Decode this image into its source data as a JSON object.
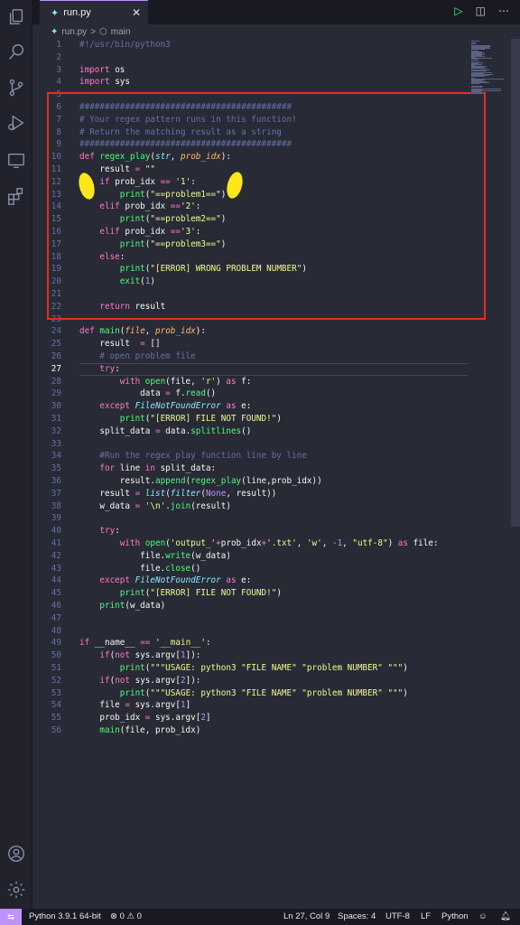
{
  "tab": {
    "icon": "python-file-icon",
    "name": "run.py",
    "close": "✕"
  },
  "breadcrumb": {
    "file": "run.py",
    "separator": ">",
    "symbol": "main"
  },
  "code_lines": [
    {
      "n": "1",
      "html": "<span class=\"cm\">#!/usr/bin/python3</span>"
    },
    {
      "n": "2",
      "html": ""
    },
    {
      "n": "3",
      "html": "<span class=\"kw\">import</span> os"
    },
    {
      "n": "4",
      "html": "<span class=\"kw\">import</span> sys"
    },
    {
      "n": "5",
      "html": ""
    },
    {
      "n": "6",
      "html": "<span class=\"cm\">##########################################</span>"
    },
    {
      "n": "7",
      "html": "<span class=\"cm\"># Your regex pattern runs in this function!</span>"
    },
    {
      "n": "8",
      "html": "<span class=\"cm\"># Return the matching result as a string</span>"
    },
    {
      "n": "9",
      "html": "<span class=\"cm\">##########################################</span>"
    },
    {
      "n": "10",
      "html": "<span class=\"kw\">def</span> <span class=\"fn\">regex_play</span>(<span class=\"bi\">str</span>, <span class=\"pa\">prob_idx</span>):"
    },
    {
      "n": "11",
      "html": "    result <span class=\"kw\">=</span> <span class=\"st\">\"\"</span>"
    },
    {
      "n": "12",
      "html": "    <span class=\"kw\">if</span> prob_idx <span class=\"kw\">==</span> <span class=\"st\">'1'</span>:"
    },
    {
      "n": "13",
      "html": "        <span class=\"fn\">print</span>(<span class=\"st\">\"==problem1==\"</span>)"
    },
    {
      "n": "14",
      "html": "    <span class=\"kw\">elif</span> prob_idx <span class=\"kw\">==</span><span class=\"st\">'2'</span>:"
    },
    {
      "n": "15",
      "html": "        <span class=\"fn\">print</span>(<span class=\"st\">\"==problem2==\"</span>)"
    },
    {
      "n": "16",
      "html": "    <span class=\"kw\">elif</span> prob_idx <span class=\"kw\">==</span><span class=\"st\">'3'</span>:"
    },
    {
      "n": "17",
      "html": "        <span class=\"fn\">print</span>(<span class=\"st\">\"==problem3==\"</span>)"
    },
    {
      "n": "18",
      "html": "    <span class=\"kw\">else</span>:"
    },
    {
      "n": "19",
      "html": "        <span class=\"fn\">print</span>(<span class=\"st\">\"[ERROR] WRONG PROBLEM NUMBER\"</span>)"
    },
    {
      "n": "20",
      "html": "        <span class=\"fn\">exit</span>(<span class=\"nu\">1</span>)"
    },
    {
      "n": "21",
      "html": ""
    },
    {
      "n": "22",
      "html": "    <span class=\"kw\">return</span> result"
    },
    {
      "n": "23",
      "html": ""
    },
    {
      "n": "24",
      "html": "<span class=\"kw\">def</span> <span class=\"fn\">main</span>(<span class=\"pa\">file</span>, <span class=\"pa\">prob_idx</span>):"
    },
    {
      "n": "25",
      "html": "    result  <span class=\"kw\">=</span> []"
    },
    {
      "n": "26",
      "html": "    <span class=\"cm\"># open problem file</span>"
    },
    {
      "n": "27",
      "html": "    <span class=\"kw\">try</span>:"
    },
    {
      "n": "28",
      "html": "        <span class=\"kw\">with</span> <span class=\"fn\">open</span>(file, <span class=\"st\">'r'</span>) <span class=\"kw\">as</span> f:"
    },
    {
      "n": "29",
      "html": "            data <span class=\"kw\">=</span> f.<span class=\"fn\">read</span>()"
    },
    {
      "n": "30",
      "html": "    <span class=\"kw\">except</span> <span class=\"bi\">FileNotFoundError</span> <span class=\"kw\">as</span> e:"
    },
    {
      "n": "31",
      "html": "        <span class=\"fn\">print</span>(<span class=\"st\">\"[ERROR] FILE NOT FOUND!\"</span>)"
    },
    {
      "n": "32",
      "html": "    split_data <span class=\"kw\">=</span> data.<span class=\"fn\">splitlines</span>()"
    },
    {
      "n": "33",
      "html": ""
    },
    {
      "n": "34",
      "html": "    <span class=\"cm\">#Run the regex_play function line by line</span>"
    },
    {
      "n": "35",
      "html": "    <span class=\"kw\">for</span> line <span class=\"kw\">in</span> split_data:"
    },
    {
      "n": "36",
      "html": "        result.<span class=\"fn\">append</span>(<span class=\"fn\">regex_play</span>(line,prob_idx))"
    },
    {
      "n": "37",
      "html": "    result <span class=\"kw\">=</span> <span class=\"bi\">list</span>(<span class=\"bi\">filter</span>(<span class=\"nu\">None</span>, result))"
    },
    {
      "n": "38",
      "html": "    w_data <span class=\"kw\">=</span> <span class=\"st\">'\\n'</span>.<span class=\"fn\">join</span>(result)"
    },
    {
      "n": "39",
      "html": ""
    },
    {
      "n": "40",
      "html": "    <span class=\"kw\">try</span>:"
    },
    {
      "n": "41",
      "html": "        <span class=\"kw\">with</span> <span class=\"fn\">open</span>(<span class=\"st\">'output_'</span><span class=\"kw\">+</span>prob_idx<span class=\"kw\">+</span><span class=\"st\">'.txt'</span>, <span class=\"st\">'w'</span>, <span class=\"kw\">-</span><span class=\"nu\">1</span>, <span class=\"st\">\"utf-8\"</span>) <span class=\"kw\">as</span> file:"
    },
    {
      "n": "42",
      "html": "            file.<span class=\"fn\">write</span>(w_data)"
    },
    {
      "n": "43",
      "html": "            file.<span class=\"fn\">close</span>()"
    },
    {
      "n": "44",
      "html": "    <span class=\"kw\">except</span> <span class=\"bi\">FileNotFoundError</span> <span class=\"kw\">as</span> e:"
    },
    {
      "n": "45",
      "html": "        <span class=\"fn\">print</span>(<span class=\"st\">\"[ERROR] FILE NOT FOUND!\"</span>)"
    },
    {
      "n": "46",
      "html": "    <span class=\"fn\">print</span>(w_data)"
    },
    {
      "n": "47",
      "html": ""
    },
    {
      "n": "48",
      "html": ""
    },
    {
      "n": "49",
      "html": "<span class=\"kw\">if</span> __name__ <span class=\"kw\">==</span> <span class=\"st\">'__main__'</span>:"
    },
    {
      "n": "50",
      "html": "    <span class=\"kw\">if</span>(<span class=\"kw\">not</span> sys.argv[<span class=\"nu\">1</span>]):"
    },
    {
      "n": "51",
      "html": "        <span class=\"fn\">print</span>(<span class=\"st\">\"\"\"USAGE: python3 \"FILE NAME\" \"problem NUMBER\" \"\"\"</span>)"
    },
    {
      "n": "52",
      "html": "    <span class=\"kw\">if</span>(<span class=\"kw\">not</span> sys.argv[<span class=\"nu\">2</span>]):"
    },
    {
      "n": "53",
      "html": "        <span class=\"fn\">print</span>(<span class=\"st\">\"\"\"USAGE: python3 \"FILE NAME\" \"problem NUMBER\" \"\"\"</span>)"
    },
    {
      "n": "54",
      "html": "    file <span class=\"kw\">=</span> sys.argv[<span class=\"nu\">1</span>]"
    },
    {
      "n": "55",
      "html": "    prob_idx <span class=\"kw\">=</span> sys.argv[<span class=\"nu\">2</span>]"
    },
    {
      "n": "56",
      "html": "    <span class=\"fn\">main</span>(file, prob_idx)"
    }
  ],
  "active_line": "27",
  "status": {
    "interpreter": "Python 3.9.1 64-bit",
    "errors": "⊗ 0 ⚠ 0",
    "position": "Ln 27, Col 9",
    "spaces": "Spaces: 4",
    "encoding": "UTF-8",
    "eol": "LF",
    "language": "Python"
  },
  "colors": {
    "accent": "#bd93f9",
    "highlight_box": "#e0301e",
    "annotation": "#ffe71a"
  }
}
